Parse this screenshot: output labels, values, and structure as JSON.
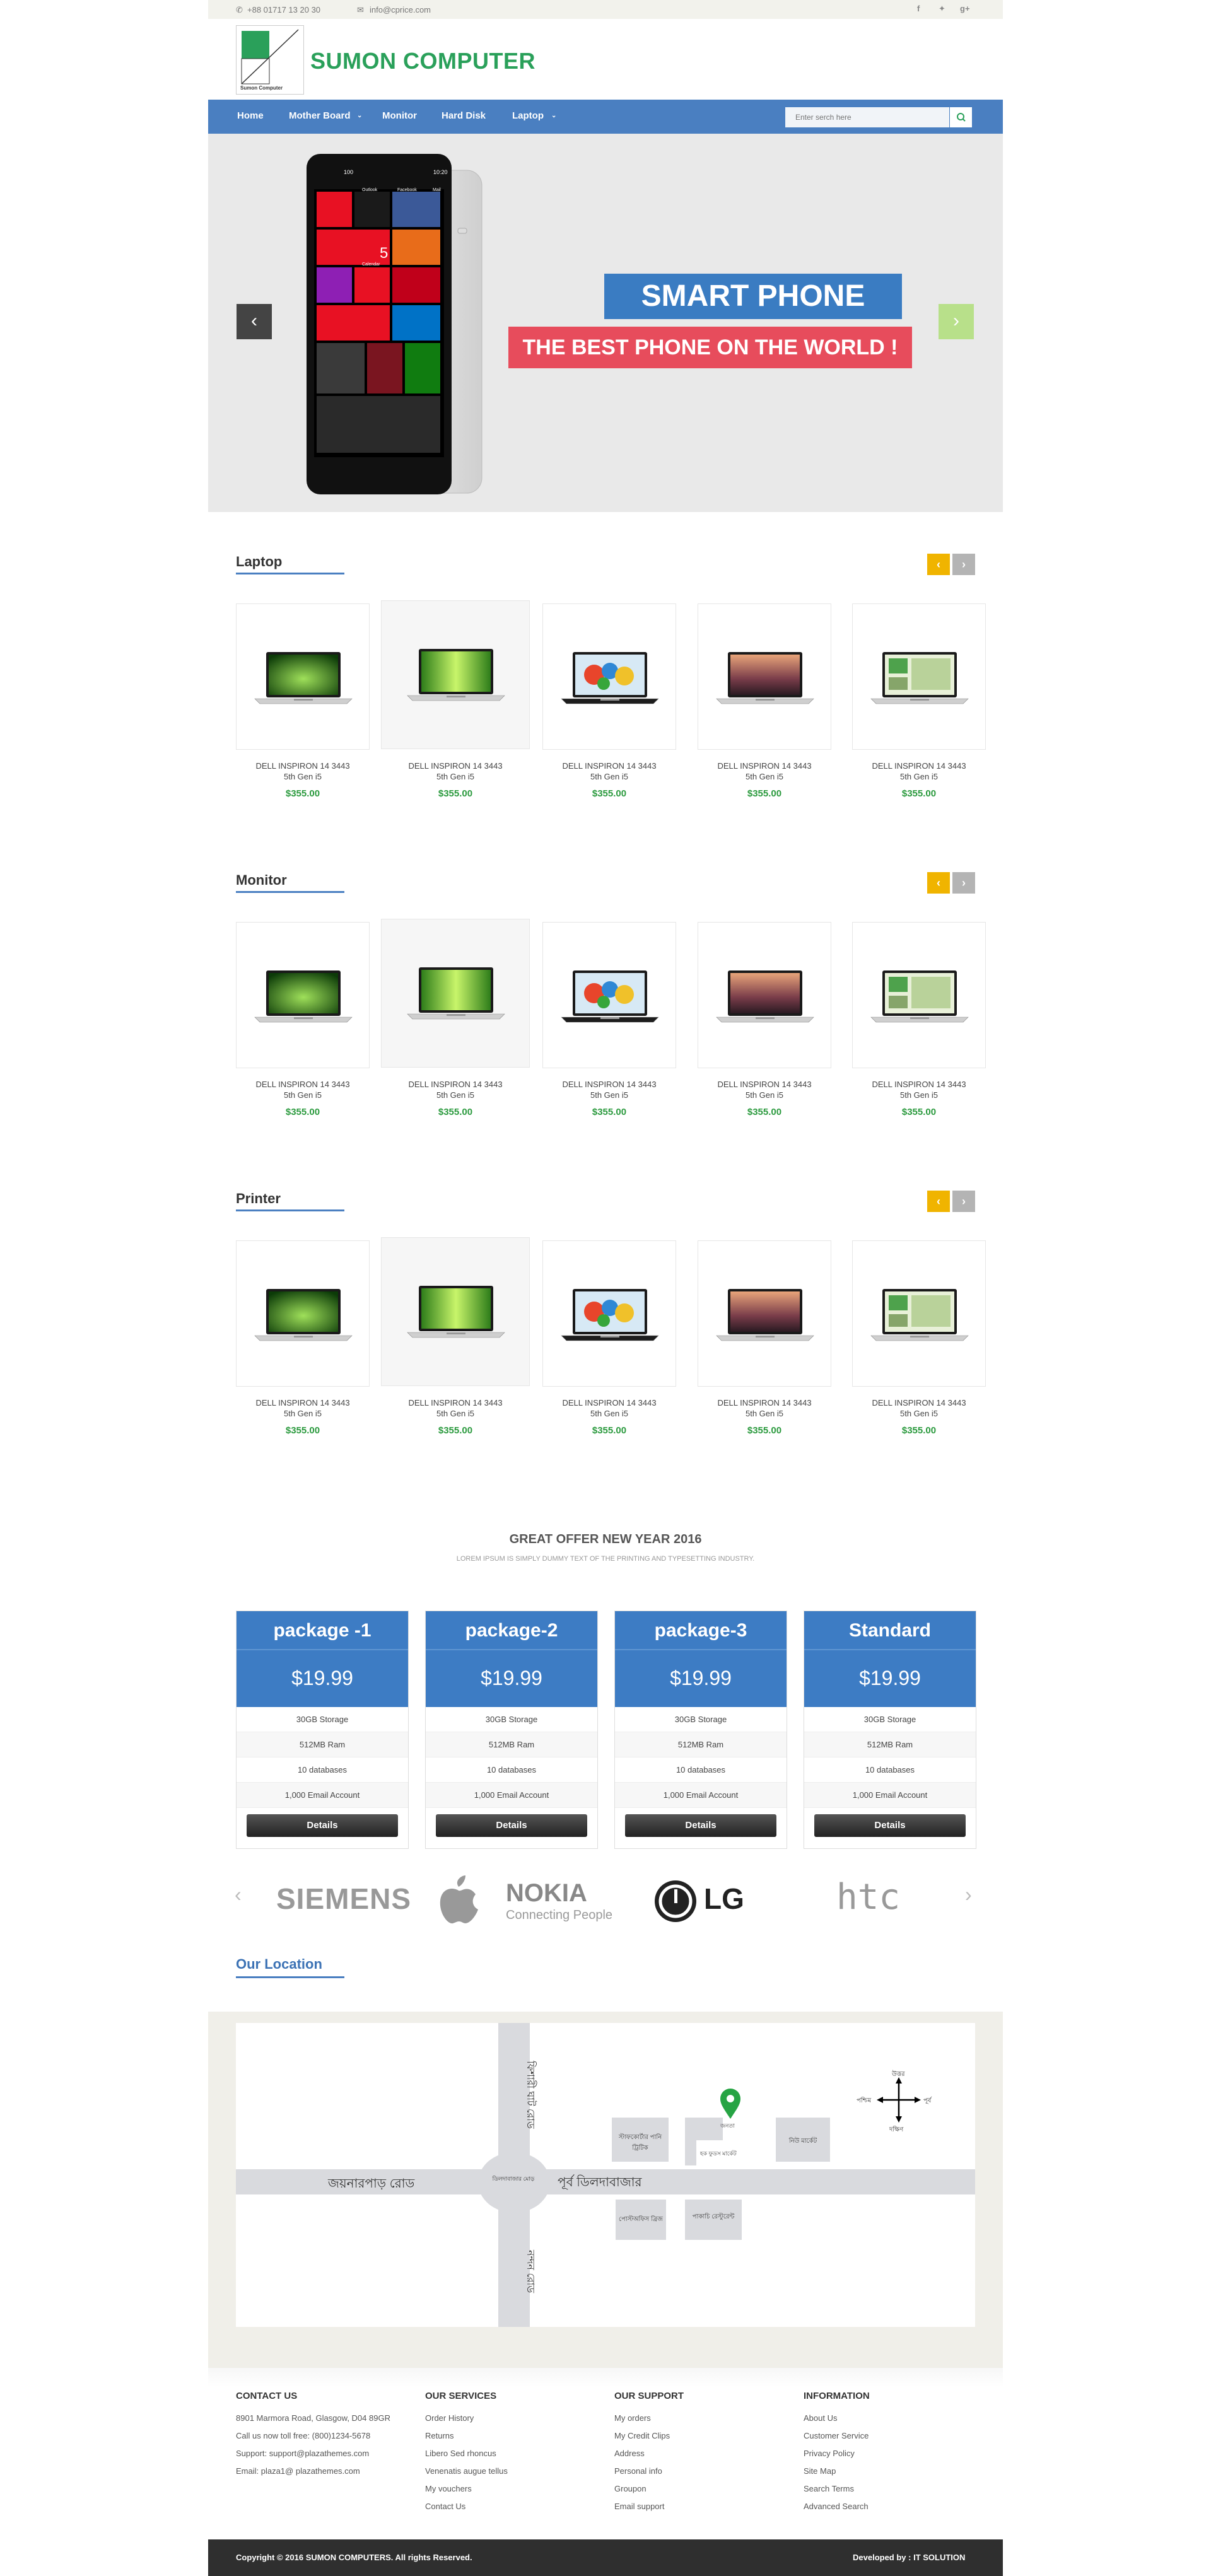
{
  "topbar": {
    "phone": "+88 01717 13 20 30",
    "email": "info@cprice.com",
    "social": [
      "facebook-icon",
      "twitter-icon",
      "google-plus-icon"
    ]
  },
  "header": {
    "logo_caption": "Sumon Computer",
    "site_title": "SUMON COMPUTER"
  },
  "nav": {
    "items": [
      "Home",
      "Mother Board",
      "Monitor",
      "Hard Disk",
      "Laptop"
    ],
    "search_placeholder": "Enter serch here"
  },
  "banner": {
    "headline": "SMART PHONE",
    "subline": "THE BEST PHONE ON THE WORLD !",
    "phone_screen": {
      "time": "10:20",
      "battery": "100",
      "date": "5",
      "tiles": [
        "Outlook",
        "Facebook",
        "Calendar",
        "Mail"
      ]
    }
  },
  "sections": [
    {
      "title": "Laptop",
      "products": [
        {
          "name": "DELL INSPIRON 14 3443",
          "spec": "5th Gen i5",
          "price": "$355.00"
        },
        {
          "name": "DELL INSPIRON 14 3443",
          "spec": "5th Gen i5",
          "price": "$355.00"
        },
        {
          "name": "DELL INSPIRON 14 3443",
          "spec": "5th Gen i5",
          "price": "$355.00"
        },
        {
          "name": "DELL INSPIRON 14 3443",
          "spec": "5th Gen i5",
          "price": "$355.00"
        },
        {
          "name": "DELL INSPIRON 14 3443",
          "spec": "5th Gen i5",
          "price": "$355.00"
        }
      ]
    },
    {
      "title": "Monitor",
      "products": [
        {
          "name": "DELL INSPIRON 14 3443",
          "spec": "5th Gen i5",
          "price": "$355.00"
        },
        {
          "name": "DELL INSPIRON 14 3443",
          "spec": "5th Gen i5",
          "price": "$355.00"
        },
        {
          "name": "DELL INSPIRON 14 3443",
          "spec": "5th Gen i5",
          "price": "$355.00"
        },
        {
          "name": "DELL INSPIRON 14 3443",
          "spec": "5th Gen i5",
          "price": "$355.00"
        },
        {
          "name": "DELL INSPIRON 14 3443",
          "spec": "5th Gen i5",
          "price": "$355.00"
        }
      ]
    },
    {
      "title": "Printer",
      "products": [
        {
          "name": "DELL INSPIRON 14 3443",
          "spec": "5th Gen i5",
          "price": "$355.00"
        },
        {
          "name": "DELL INSPIRON 14 3443",
          "spec": "5th Gen i5",
          "price": "$355.00"
        },
        {
          "name": "DELL INSPIRON 14 3443",
          "spec": "5th Gen i5",
          "price": "$355.00"
        },
        {
          "name": "DELL INSPIRON 14 3443",
          "spec": "5th Gen i5",
          "price": "$355.00"
        },
        {
          "name": "DELL INSPIRON 14 3443",
          "spec": "5th Gen i5",
          "price": "$355.00"
        }
      ]
    }
  ],
  "offer": {
    "title": "GREAT OFFER NEW YEAR 2016",
    "subtitle": "LOREM IPSUM IS SIMPLY DUMMY TEXT OF THE PRINTING AND TYPESETTING INDUSTRY.",
    "plans": [
      {
        "name": "package -1",
        "price": "$19.99",
        "features": [
          "30GB Storage",
          "512MB Ram",
          "10 databases",
          "1,000 Email Account"
        ],
        "button": "Details"
      },
      {
        "name": "package-2",
        "price": "$19.99",
        "features": [
          "30GB Storage",
          "512MB Ram",
          "10 databases",
          "1,000 Email Account"
        ],
        "button": "Details"
      },
      {
        "name": "package-3",
        "price": "$19.99",
        "features": [
          "30GB Storage",
          "512MB Ram",
          "10 databases",
          "1,000 Email Account"
        ],
        "button": "Details"
      },
      {
        "name": "Standard",
        "price": "$19.99",
        "features": [
          "30GB Storage",
          "512MB Ram",
          "10 databases",
          "1,000 Email Account"
        ],
        "button": "Details"
      }
    ]
  },
  "brands": {
    "siemens": "SIEMENS",
    "nokia": "NOKIA",
    "nokia_tagline": "Connecting People",
    "lg": "LG",
    "htc": "htc"
  },
  "location": {
    "title": "Our Location",
    "map_labels": {
      "road_west": "জয়নারপাড় রোড",
      "road_east": "পূর্ব ডিলদাবাজার",
      "road_north": "ফিশারী ঘাট রোড",
      "road_south": "নন্দন রোড",
      "circle": "ডিলদাবাজার মোড়",
      "block1": "স্টাফকোর্টার পানি ট্রিটিক",
      "block2": "মহাস্থান",
      "block3": "হক ফুডস মার্কেট",
      "block4": "পোস্টঅফিস ব্রিজ",
      "block5": "নিউ মার্কেট",
      "block6": "পাকাচি রেস্টুরেন্ট",
      "marker_label": "জনতা",
      "compass_n": "উত্তর",
      "compass_s": "দক্ষিণ",
      "compass_e": "পূর্ব",
      "compass_w": "পশ্চিম"
    }
  },
  "footer": {
    "contact": {
      "title": "CONTACT US",
      "lines": [
        "8901 Marmora Road, Glasgow, D04 89GR",
        "Call us now toll free: (800)1234-5678",
        "Support: support@plazathemes.com",
        "Email: plaza1@ plazathemes.com"
      ]
    },
    "services": {
      "title": "OUR SERVICES",
      "items": [
        "Order History",
        "Returns",
        "Libero Sed rhoncus",
        "Venenatis augue tellus",
        "My vouchers",
        "Contact Us"
      ]
    },
    "support": {
      "title": "OUR SUPPORT",
      "items": [
        "My orders",
        "My Credit Clips",
        "Address",
        "Personal info",
        "Groupon",
        "Email support"
      ]
    },
    "information": {
      "title": "INFORMATION",
      "items": [
        "About Us",
        "Customer Service",
        "Privacy Policy",
        "Site Map",
        "Search Terms",
        "Advanced Search"
      ]
    }
  },
  "bottom": {
    "copyright": "Copyright © 2016 SUMON COMPUTERS. All rights Reserved.",
    "developer": "Developed by : IT SOLUTION"
  },
  "colors": {
    "brand_green": "#2aa05a",
    "nav_blue": "#4a7fc1",
    "price_green": "#2b9a3e",
    "accent_yellow": "#f0b400",
    "hero_red": "#e74c5c"
  }
}
